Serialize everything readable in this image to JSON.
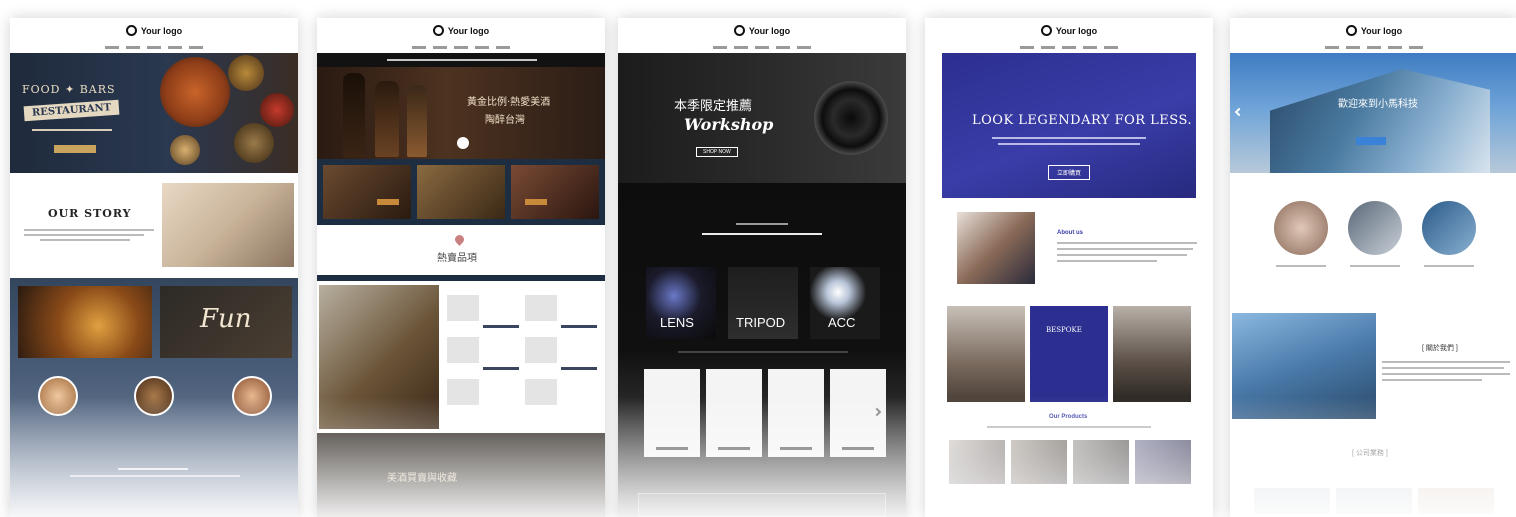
{
  "logo_text": "Your logo",
  "templates": [
    {
      "hero_title_line1": "FOOD ✦ BARS",
      "hero_title_banner": "RESTAURANT",
      "story_title": "OUR STORY",
      "video_badge": "Fun"
    },
    {
      "hero_text_line1": "黃金比例‧熱愛美酒",
      "hero_text_line2": "陶醉台灣",
      "hot_title": "熱賣品項",
      "bottom_text": "美酒買賣與收藏"
    },
    {
      "hero_title": "本季限定推薦",
      "hero_script": "Workshop",
      "hero_button": "SHOP NOW",
      "cards": [
        "LENS",
        "TRIPOD",
        "ACC"
      ]
    },
    {
      "hero_title": "LOOK LEGENDARY FOR LESS.",
      "hero_button": "立即購買",
      "about_title": "About us",
      "photo_text": "BESPOKE",
      "products_title": "Our Products"
    },
    {
      "hero_text": "歡迎來到小馬科技",
      "about_title": "[ 關於我們 ]",
      "cases_title": "[ 公司業務 ]"
    }
  ]
}
